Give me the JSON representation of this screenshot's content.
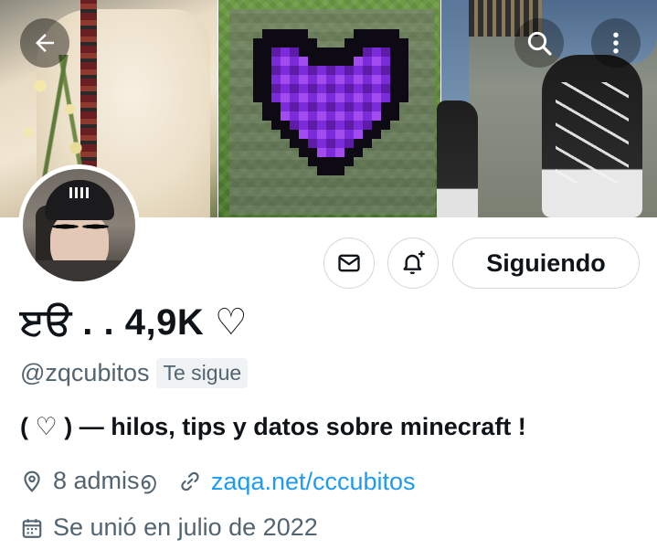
{
  "header": {
    "back_icon": "arrow-left-icon",
    "search_icon": "search-icon",
    "more_icon": "more-vertical-icon"
  },
  "profile": {
    "display_name": "ੲੳ . . 4,9K ♡",
    "handle": "@zqcubitos",
    "follows_you_badge": "Te sigue",
    "bio": "( ♡ ) — hilos, tips y datos sobre minecraft !",
    "location": "8 admis൭",
    "link": "zaqa.net/cccubitos",
    "joined": "Se unió en julio de 2022"
  },
  "actions": {
    "message_icon": "mail-icon",
    "notify_icon": "bell-plus-icon",
    "follow_label": "Siguiendo"
  },
  "colors": {
    "link": "#1d9bf0",
    "secondary_text": "#536471",
    "border": "#cfd9de",
    "portal_purple": "#8a2be2"
  }
}
